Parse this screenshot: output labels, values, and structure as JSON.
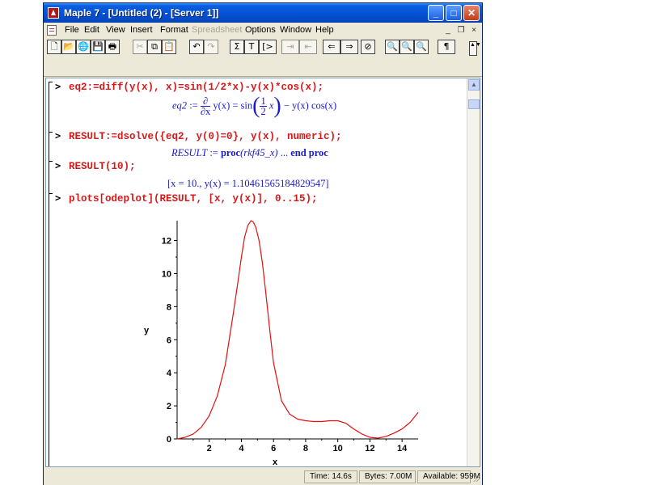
{
  "window": {
    "title": "Maple 7 - [Untitled (2) - [Server 1]]",
    "controls": {
      "minimize": "_",
      "maximize": "□",
      "close": "✕"
    }
  },
  "menu": {
    "items": [
      {
        "label": "File",
        "enabled": true
      },
      {
        "label": "Edit",
        "enabled": true
      },
      {
        "label": "View",
        "enabled": true
      },
      {
        "label": "Insert",
        "enabled": true
      },
      {
        "label": "Format",
        "enabled": true
      },
      {
        "label": "Spreadsheet",
        "enabled": false
      },
      {
        "label": "Options",
        "enabled": true
      },
      {
        "label": "Window",
        "enabled": true
      },
      {
        "label": "Help",
        "enabled": true
      }
    ],
    "mdi": {
      "minimize": "_",
      "restore": "❐",
      "close": "×"
    }
  },
  "toolbar": {
    "new": "🗋",
    "open": "📂",
    "open_url": "🌐",
    "save": "💾",
    "print": "🖶",
    "cut": "✂",
    "copy": "⧉",
    "paste": "📋",
    "undo": "↶",
    "redo": "↷",
    "sum": "Σ",
    "text": "T",
    "insert_input": "[>",
    "indent": "⇥",
    "outdent": "⇤",
    "back": "⇐",
    "forward": "⇒",
    "stop": "⊘",
    "zoom_small": "🔍",
    "zoom_medium": "🔍",
    "zoom_large": "🔍",
    "pilcrow": "¶",
    "scroll": "▲▼"
  },
  "worksheet": {
    "prompt": ">",
    "cmd1": "eq2:=diff(y(x), x)=sin(1/2*x)-y(x)*cos(x);",
    "out1": {
      "lhs": "eq2",
      "assign": ":=",
      "partial_num": "∂",
      "partial_den": "∂x",
      "yx": "y(x) = sin",
      "frac_num": "1",
      "frac_den": "2",
      "x": "x",
      "rest": "− y(x) cos(x)"
    },
    "cmd2": "RESULT:=dsolve({eq2, y(0)=0}, y(x), numeric);",
    "out2": {
      "lhs": "RESULT",
      "assign": ":=",
      "proc": "proc",
      "arg": "(rkf45_x)",
      "dots": "...",
      "end": "end proc"
    },
    "cmd3": "RESULT(10);",
    "out3": "[x = 10., y(x) = 1.10461565184829547]",
    "cmd4": "plots[odeplot](RESULT, [x, y(x)], 0..15);"
  },
  "chart_data": {
    "type": "line",
    "xlabel": "x",
    "ylabel": "y",
    "xlim": [
      0,
      15
    ],
    "ylim": [
      0,
      13.2
    ],
    "xticks": [
      2,
      4,
      6,
      8,
      10,
      12,
      14
    ],
    "yticks": [
      0,
      2,
      4,
      6,
      8,
      10,
      12
    ],
    "color": "#e01010",
    "series": [
      {
        "x": [
          0,
          0.5,
          1,
          1.5,
          2,
          2.5,
          3,
          3.5,
          3.8,
          4.0,
          4.2,
          4.4,
          4.6,
          4.75,
          4.9,
          5.1,
          5.3,
          5.5,
          5.8,
          6.0,
          6.5,
          7.0,
          7.5,
          8.0,
          8.5,
          9.0,
          9.5,
          10.0,
          10.5,
          11.0,
          11.5,
          12.0,
          12.5,
          13.0,
          13.5,
          14.0,
          14.5,
          15.0
        ],
        "y": [
          0,
          0.1,
          0.3,
          0.7,
          1.4,
          2.6,
          4.5,
          7.6,
          9.6,
          11.0,
          12.2,
          12.9,
          13.2,
          13.1,
          12.8,
          12.0,
          10.7,
          9.0,
          6.3,
          4.6,
          2.3,
          1.5,
          1.2,
          1.1,
          1.05,
          1.05,
          1.1,
          1.1,
          0.95,
          0.6,
          0.3,
          0.1,
          0.05,
          0.15,
          0.35,
          0.6,
          1.0,
          1.6
        ]
      }
    ]
  },
  "status": {
    "time_label": "Time: 14.6s",
    "bytes_label": "Bytes: 7.00M",
    "available_label": "Available: 959M"
  }
}
